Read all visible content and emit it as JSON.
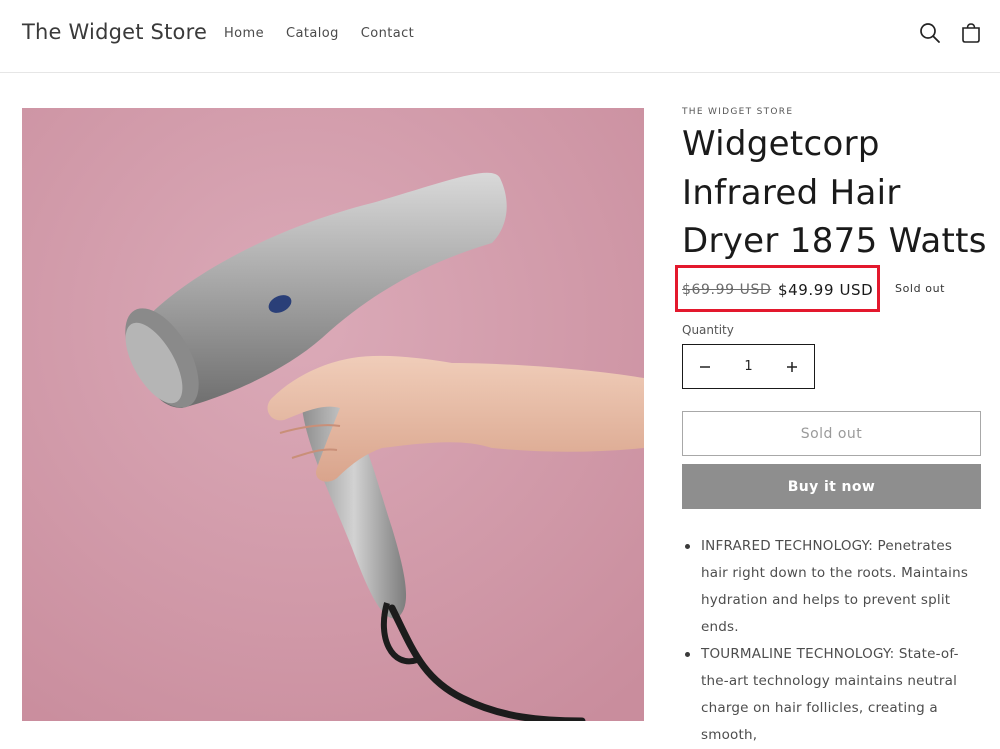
{
  "header": {
    "logo": "The Widget Store",
    "nav": [
      "Home",
      "Catalog",
      "Contact"
    ],
    "icons": [
      "search-icon",
      "cart-icon"
    ]
  },
  "product": {
    "vendor": "THE WIDGET STORE",
    "title": "Widgetcorp Infrared Hair Dryer 1875 Watts",
    "price_regular": "$69.99 USD",
    "price_sale": "$49.99 USD",
    "badge": "Sold out",
    "quantity_label": "Quantity",
    "quantity_value": "1",
    "sold_out_button": "Sold out",
    "buy_button": "Buy it now",
    "description": [
      "INFRARED TECHNOLOGY: Penetrates hair right down to the roots. Maintains hydration and helps to prevent split ends.",
      "TOURMALINE TECHNOLOGY: State-of-the-art technology maintains neutral charge on hair follicles, creating a smooth,"
    ]
  },
  "colors": {
    "highlight_box": "#e3182d",
    "buy_button_bg": "#8e8e8e",
    "image_bg": "#d4a3b0"
  }
}
